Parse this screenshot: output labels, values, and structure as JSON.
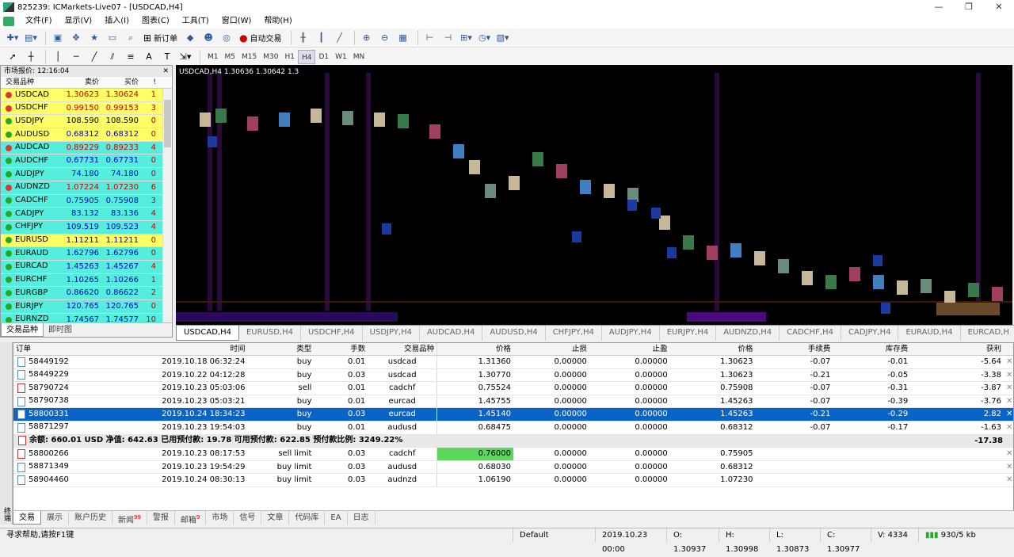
{
  "window": {
    "title": "825239: ICMarkets-Live07 - [USDCAD,H4]"
  },
  "menu": [
    "文件(F)",
    "显示(V)",
    "插入(I)",
    "图表(C)",
    "工具(T)",
    "窗口(W)",
    "帮助(H)"
  ],
  "toolbar": {
    "new_order": "新订单",
    "auto_trade": "自动交易",
    "timeframes": [
      "M1",
      "M5",
      "M15",
      "M30",
      "H1",
      "H4",
      "D1",
      "W1",
      "MN"
    ],
    "active_tf": "H4"
  },
  "market_watch": {
    "title": "市场报价: 12:16:04",
    "cols": [
      "交易品种",
      "卖价",
      "买价",
      "!"
    ],
    "rows": [
      {
        "sym": "USDCAD",
        "bid": "1.30623",
        "ask": "1.30624",
        "sp": "1",
        "bg": "#ffff66",
        "dir": "dn"
      },
      {
        "sym": "USDCHF",
        "bid": "0.99150",
        "ask": "0.99153",
        "sp": "3",
        "bg": "#ffff66",
        "dir": "dn"
      },
      {
        "sym": "USDJPY",
        "bid": "108.590",
        "ask": "108.590",
        "sp": "0",
        "bg": "#ffff66",
        "dir": "nz"
      },
      {
        "sym": "AUDUSD",
        "bid": "0.68312",
        "ask": "0.68312",
        "sp": "0",
        "bg": "#ffff66",
        "dir": "up"
      },
      {
        "sym": "AUDCAD",
        "bid": "0.89229",
        "ask": "0.89233",
        "sp": "4",
        "bg": "#55eedd",
        "dir": "dn"
      },
      {
        "sym": "AUDCHF",
        "bid": "0.67731",
        "ask": "0.67731",
        "sp": "0",
        "bg": "#55eedd",
        "dir": "up"
      },
      {
        "sym": "AUDJPY",
        "bid": "74.180",
        "ask": "74.180",
        "sp": "0",
        "bg": "#55eedd",
        "dir": "up"
      },
      {
        "sym": "AUDNZD",
        "bid": "1.07224",
        "ask": "1.07230",
        "sp": "6",
        "bg": "#55eedd",
        "dir": "dn"
      },
      {
        "sym": "CADCHF",
        "bid": "0.75905",
        "ask": "0.75908",
        "sp": "3",
        "bg": "#55eedd",
        "dir": "up"
      },
      {
        "sym": "CADJPY",
        "bid": "83.132",
        "ask": "83.136",
        "sp": "4",
        "bg": "#55eedd",
        "dir": "up"
      },
      {
        "sym": "CHFJPY",
        "bid": "109.519",
        "ask": "109.523",
        "sp": "4",
        "bg": "#55eedd",
        "dir": "up"
      },
      {
        "sym": "EURUSD",
        "bid": "1.11211",
        "ask": "1.11211",
        "sp": "0",
        "bg": "#ffff66",
        "dir": "up"
      },
      {
        "sym": "EURAUD",
        "bid": "1.62796",
        "ask": "1.62796",
        "sp": "0",
        "bg": "#55eedd",
        "dir": "up"
      },
      {
        "sym": "EURCAD",
        "bid": "1.45263",
        "ask": "1.45267",
        "sp": "4",
        "bg": "#55eedd",
        "dir": "up"
      },
      {
        "sym": "EURCHF",
        "bid": "1.10265",
        "ask": "1.10266",
        "sp": "1",
        "bg": "#55eedd",
        "dir": "up"
      },
      {
        "sym": "EURGBP",
        "bid": "0.86620",
        "ask": "0.86622",
        "sp": "2",
        "bg": "#55eedd",
        "dir": "up"
      },
      {
        "sym": "EURJPY",
        "bid": "120.765",
        "ask": "120.765",
        "sp": "0",
        "bg": "#55eedd",
        "dir": "up"
      },
      {
        "sym": "EURNZD",
        "bid": "1.74567",
        "ask": "1.74577",
        "sp": "10",
        "bg": "#55eedd",
        "dir": "up"
      }
    ],
    "tabs": [
      "交易品种",
      "即时图"
    ]
  },
  "chart": {
    "header": "USDCAD,H4  1.30636 1.30642 1.3"
  },
  "chart_tabs": [
    "USDCAD,H4",
    "EURUSD,H4",
    "USDCHF,H4",
    "USDJPY,H4",
    "AUDCAD,H4",
    "AUDUSD,H4",
    "CHFJPY,H4",
    "AUDJPY,H4",
    "EURJPY,H4",
    "AUDNZD,H4",
    "CADCHF,H4",
    "CADJPY,H4",
    "EURAUD,H4",
    "EURCAD,H"
  ],
  "terminal": {
    "cols": [
      "订单",
      "时间",
      "类型",
      "手数",
      "交易品种",
      "价格",
      "止损",
      "止盈",
      "价格",
      "手续费",
      "库存费",
      "获利"
    ],
    "rows": [
      [
        "58449192",
        "2019.10.18 06:32:24",
        "buy",
        "0.01",
        "usdcad",
        "1.31360",
        "0.00000",
        "0.00000",
        "1.30623",
        "-0.07",
        "-0.01",
        "-5.64"
      ],
      [
        "58449229",
        "2019.10.22 04:12:28",
        "buy",
        "0.03",
        "usdcad",
        "1.30770",
        "0.00000",
        "0.00000",
        "1.30623",
        "-0.21",
        "-0.05",
        "-3.38"
      ],
      [
        "58790724",
        "2019.10.23 05:03:06",
        "sell",
        "0.01",
        "cadchf",
        "0.75524",
        "0.00000",
        "0.00000",
        "0.75908",
        "-0.07",
        "-0.31",
        "-3.87"
      ],
      [
        "58790738",
        "2019.10.23 05:03:21",
        "buy",
        "0.01",
        "eurcad",
        "1.45755",
        "0.00000",
        "0.00000",
        "1.45263",
        "-0.07",
        "-0.39",
        "-3.76"
      ],
      [
        "58800331",
        "2019.10.24 18:34:23",
        "buy",
        "0.03",
        "eurcad",
        "1.45140",
        "0.00000",
        "0.00000",
        "1.45263",
        "-0.21",
        "-0.29",
        "2.82"
      ],
      [
        "58871297",
        "2019.10.23 19:54:03",
        "buy",
        "0.01",
        "audusd",
        "0.68475",
        "0.00000",
        "0.00000",
        "0.68312",
        "-0.07",
        "-0.17",
        "-1.63"
      ]
    ],
    "balance": "余额: 660.01 USD  净值: 642.63  已用预付款: 19.78  可用预付款: 622.85  预付款比例: 3249.22%",
    "balance_total": "-17.38",
    "pending": [
      [
        "58800266",
        "2019.10.23 08:17:53",
        "sell limit",
        "0.03",
        "cadchf",
        "0.76000",
        "0.00000",
        "0.00000",
        "0.75905"
      ],
      [
        "58871349",
        "2019.10.23 19:54:29",
        "buy limit",
        "0.03",
        "audusd",
        "0.68030",
        "0.00000",
        "0.00000",
        "0.68312"
      ],
      [
        "58904460",
        "2019.10.24 08:30:13",
        "buy limit",
        "0.03",
        "audnzd",
        "1.06190",
        "0.00000",
        "0.00000",
        "1.07230"
      ]
    ],
    "tabs": [
      "交易",
      "展示",
      "账户历史",
      "新闻",
      "警报",
      "邮箱",
      "市场",
      "信号",
      "文章",
      "代码库",
      "EA",
      "日志"
    ],
    "news_badge": "99",
    "mail_badge": "9",
    "side_label": "终端"
  },
  "status": {
    "help": "寻求帮助,请按F1键",
    "profile": "Default",
    "time": "2019.10.23 00:00",
    "open": "O: 1.30937",
    "high": "H: 1.30998",
    "low": "L: 1.30873",
    "close": "C: 1.30977",
    "vol": "V: 4334",
    "traffic": "930/5 kb"
  }
}
